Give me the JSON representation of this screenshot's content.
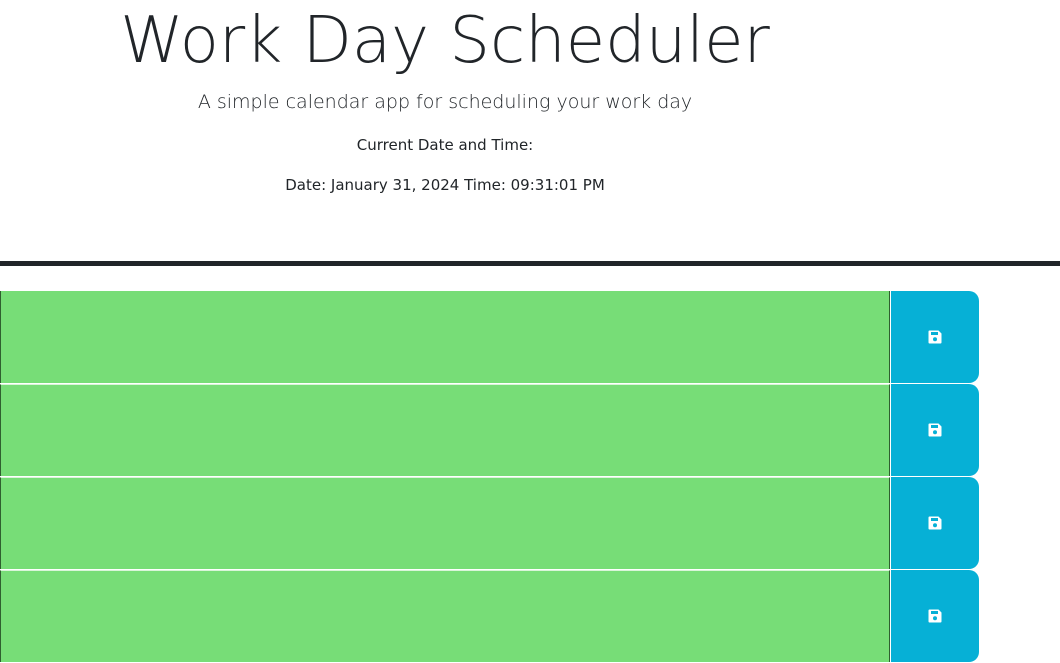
{
  "header": {
    "title": "Work Day Scheduler",
    "subtitle": "A simple calendar app for scheduling your work day",
    "current_label": "Current Date and Time:",
    "current_datetime": "Date: January 31, 2024 Time: 09:31:01 PM"
  },
  "time_blocks": [
    {
      "description": "",
      "status": "future",
      "color": "#77dd77"
    },
    {
      "description": "",
      "status": "future",
      "color": "#77dd77"
    },
    {
      "description": "",
      "status": "future",
      "color": "#77dd77"
    },
    {
      "description": "",
      "status": "future",
      "color": "#77dd77"
    }
  ],
  "save_button": {
    "icon": "save-icon",
    "color": "#06b0d6"
  }
}
